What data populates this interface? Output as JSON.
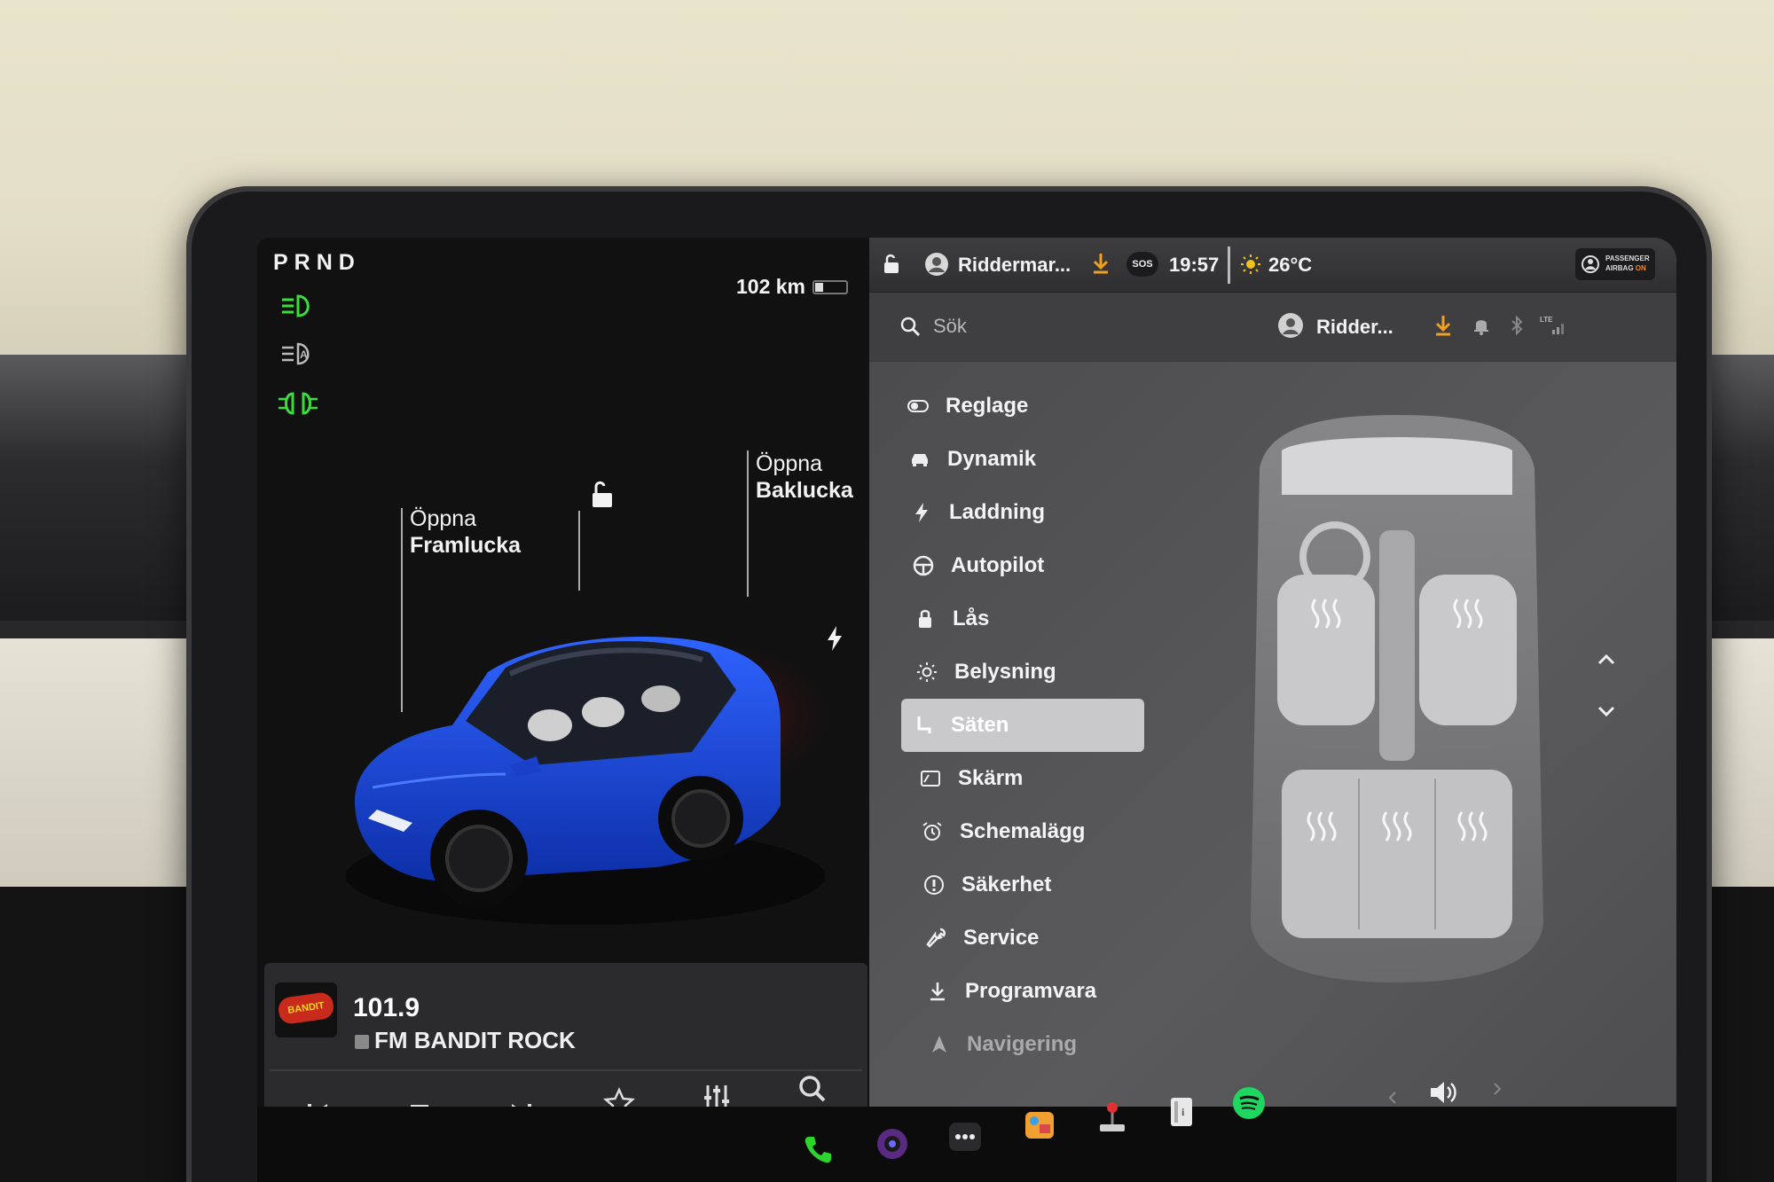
{
  "gear": "PRND",
  "range": "102 km",
  "battery_level": 0.25,
  "car": {
    "front_trunk_l1": "Öppna",
    "front_trunk_l2": "Framlucka",
    "rear_trunk_l1": "Öppna",
    "rear_trunk_l2": "Baklucka",
    "paint_color": "#1f47d6"
  },
  "media": {
    "frequency": "101.9",
    "station": "FM BANDIT ROCK",
    "logo_text": "BANDIT",
    "page_dots": 3,
    "active_page": 0
  },
  "status": {
    "profile": "Riddermar...",
    "time": "19:57",
    "temperature": "26°C",
    "sos": "SOS",
    "airbag_l1": "PASSENGER",
    "airbag_l2": "AIRBAG",
    "airbag_state": "ON"
  },
  "search": {
    "placeholder": "Sök"
  },
  "header_profile": "Ridder...",
  "menu": [
    {
      "label": "Reglage",
      "icon": "toggle-icon"
    },
    {
      "label": "Dynamik",
      "icon": "car-icon"
    },
    {
      "label": "Laddning",
      "icon": "bolt-icon"
    },
    {
      "label": "Autopilot",
      "icon": "steering-wheel-icon"
    },
    {
      "label": "Lås",
      "icon": "lock-icon"
    },
    {
      "label": "Belysning",
      "icon": "sun-icon"
    },
    {
      "label": "Säten",
      "icon": "seat-icon",
      "active": true
    },
    {
      "label": "Skärm",
      "icon": "display-icon"
    },
    {
      "label": "Schemalägg",
      "icon": "alarm-icon"
    },
    {
      "label": "Säkerhet",
      "icon": "info-icon"
    },
    {
      "label": "Service",
      "icon": "wrench-icon"
    },
    {
      "label": "Programvara",
      "icon": "download-icon"
    },
    {
      "label": "Navigering",
      "icon": "navigation-icon"
    }
  ],
  "colors": {
    "accent_green": "#3ddc3d",
    "download_orange": "#f0a020",
    "spotify_green": "#1ed760"
  }
}
